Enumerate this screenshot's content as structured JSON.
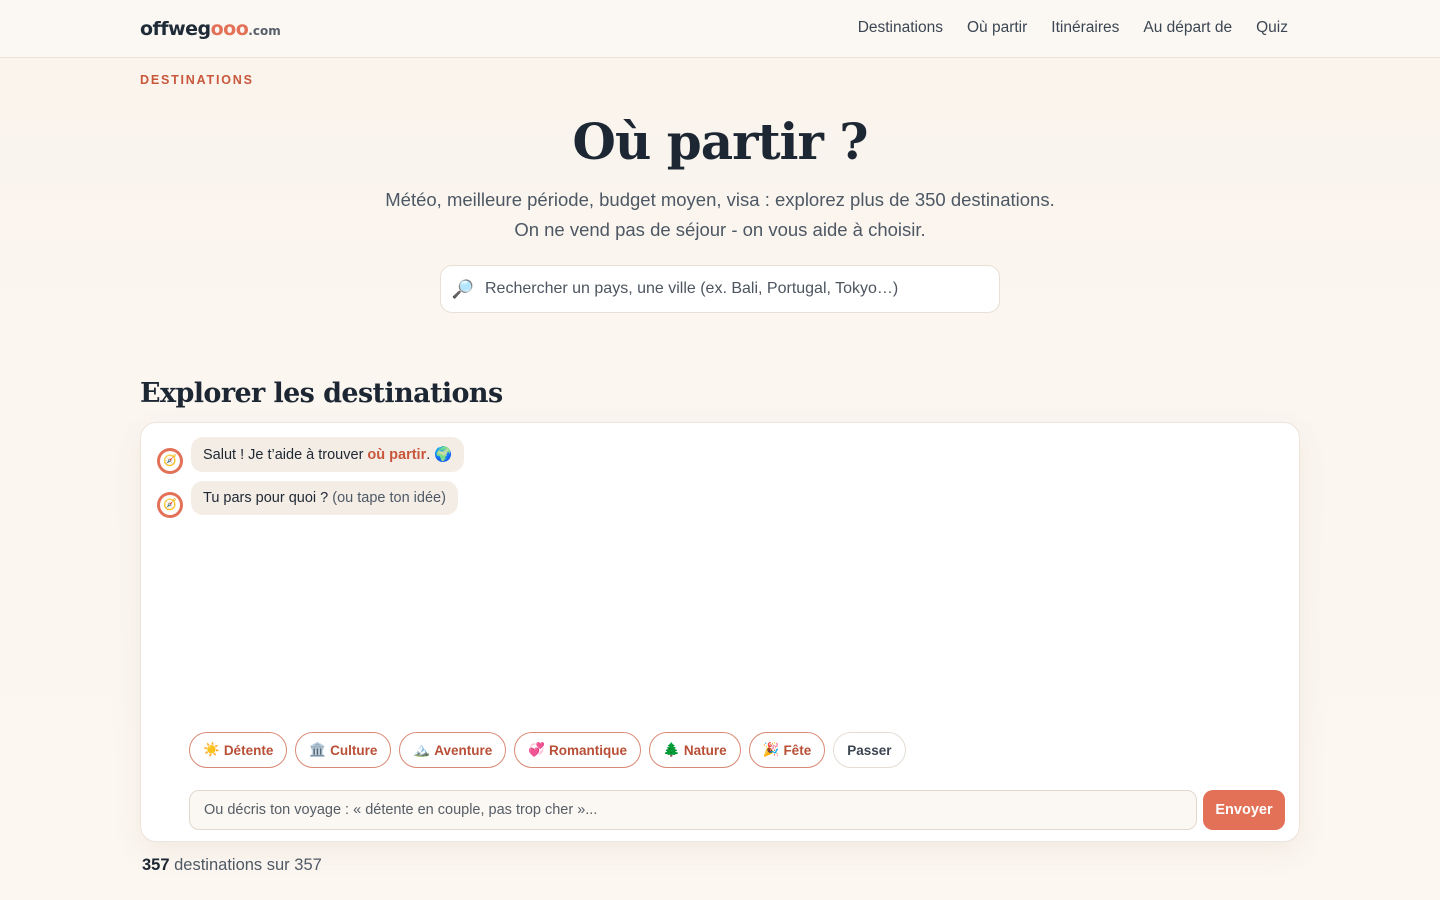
{
  "header": {
    "logo_part1": "offweg",
    "logo_part2": "ooo",
    "logo_part3": ".com",
    "nav": [
      {
        "label": "Destinations"
      },
      {
        "label": "Où partir"
      },
      {
        "label": "Itinéraires"
      },
      {
        "label": "Au départ de"
      },
      {
        "label": "Quiz"
      }
    ]
  },
  "hero": {
    "eyebrow": "DESTINATIONS",
    "title": "Où partir ?",
    "subtitle_line1": "Météo, meilleure période, budget moyen, visa : explorez plus de 350 destinations.",
    "subtitle_line2": "On ne vend pas de séjour - on vous aide à choisir.",
    "search_placeholder": "Rechercher un pays, une ville (ex. Bali, Portugal, Tokyo…)"
  },
  "explore": {
    "title": "Explorer les destinations",
    "messages": [
      {
        "text_before": "Salut ! Je t’aide à trouver ",
        "highlight": "où partir",
        "text_after": ". 🌍"
      },
      {
        "text_before": "Tu pars pour quoi ? ",
        "muted": "(ou tape ton idée)"
      }
    ],
    "chips": [
      {
        "emoji": "☀️",
        "label": "Détente"
      },
      {
        "emoji": "🏛️",
        "label": "Culture"
      },
      {
        "emoji": "🏔️",
        "label": "Aventure"
      },
      {
        "emoji": "💞",
        "label": "Romantique"
      },
      {
        "emoji": "🌲",
        "label": "Nature"
      },
      {
        "emoji": "🎉",
        "label": "Fête"
      }
    ],
    "skip_label": "Passer",
    "composer_placeholder": "Ou décris ton voyage : « détente en couple, pas trop cher »...",
    "send_label": "Envoyer"
  },
  "results": {
    "count": "357",
    "suffix": " destinations sur 357"
  },
  "colors": {
    "accent": "#e27157",
    "accent_dark": "#c8573c",
    "text": "#1d2733"
  }
}
